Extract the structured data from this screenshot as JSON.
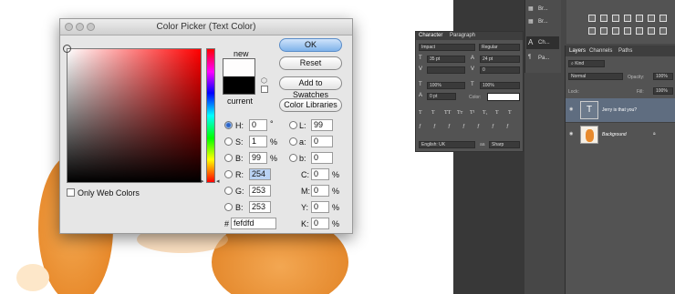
{
  "dialog": {
    "title": "Color Picker (Text Color)",
    "new_label": "new",
    "current_label": "current",
    "only_web_colors": "Only Web Colors",
    "buttons": {
      "ok": "OK",
      "reset": "Reset",
      "add_swatches": "Add to Swatches",
      "libraries": "Color Libraries"
    },
    "hsb": {
      "h_label": "H:",
      "h": "0",
      "h_unit": "°",
      "s_label": "S:",
      "s": "1",
      "s_unit": "%",
      "b_label": "B:",
      "b": "99",
      "b_unit": "%"
    },
    "rgb": {
      "r_label": "R:",
      "r": "254",
      "g_label": "G:",
      "g": "253",
      "b_label": "B:",
      "b": "253"
    },
    "lab": {
      "l_label": "L:",
      "l": "99",
      "a_label": "a:",
      "a": "0",
      "b_label": "b:",
      "b": "0"
    },
    "cmyk": {
      "c_label": "C:",
      "c": "0",
      "m_label": "M:",
      "m": "0",
      "y_label": "Y:",
      "y": "0",
      "k_label": "K:",
      "k": "0",
      "unit": "%"
    },
    "hex_label": "#",
    "hex": "fefdfd",
    "new_color": "#fefdfd",
    "current_color": "#000000"
  },
  "character_panel": {
    "tabs": [
      "Character",
      "Paragraph"
    ],
    "font": "Impact",
    "style": "Regular",
    "size": "35 pt",
    "leading": "24 pt",
    "tracking": "0",
    "vscale": "100%",
    "hscale": "100%",
    "baseline": "0 pt",
    "color_label": "Color:",
    "language": "English: UK",
    "antialias": "Sharp"
  },
  "side_dock": {
    "items": [
      "Br...",
      "Br...",
      "Ch...",
      "Pa..."
    ]
  },
  "layers_panel": {
    "tabs": [
      "Layers",
      "Channels",
      "Paths"
    ],
    "kind": "Kind",
    "blend": "Normal",
    "opacity_label": "Opacity:",
    "opacity": "100%",
    "lock_label": "Lock:",
    "fill_label": "Fill:",
    "fill": "100%",
    "layers": [
      {
        "name": "Jerry is that you?",
        "type": "text"
      },
      {
        "name": "Background",
        "type": "image"
      }
    ]
  }
}
